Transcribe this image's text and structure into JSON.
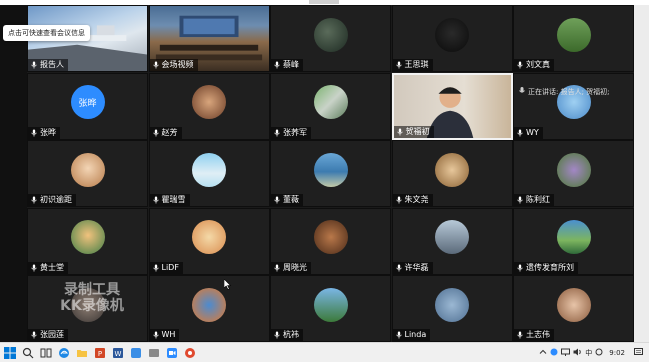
{
  "tooltip": "点击可快速查看会议信息",
  "speaking_indicator": "正在讲话: 报告人; 贺福初;",
  "watermark": {
    "line1": "录制工具",
    "line2": "KK录像机"
  },
  "tiles": [
    {
      "name": "报告人",
      "kind": "video-room"
    },
    {
      "name": "会场视频",
      "kind": "video-hall"
    },
    {
      "name": "蔡峰",
      "kind": "avatar-dark"
    },
    {
      "name": "王思琪",
      "kind": "avatar-dog"
    },
    {
      "name": "刘文真",
      "kind": "avatar-field"
    },
    {
      "name": "张晔",
      "kind": "initials",
      "initials": "张晔"
    },
    {
      "name": "赵芳",
      "kind": "avatar-cartoon"
    },
    {
      "name": "张荞军",
      "kind": "avatar-rail"
    },
    {
      "name": "贺福初",
      "kind": "video-person"
    },
    {
      "name": "WY",
      "kind": "avatar-sky"
    },
    {
      "name": "初识逾距",
      "kind": "avatar-face"
    },
    {
      "name": "瞿瑞雪",
      "kind": "avatar-beach"
    },
    {
      "name": "董薇",
      "kind": "avatar-coast"
    },
    {
      "name": "朱文尧",
      "kind": "avatar-bear"
    },
    {
      "name": "陈利红",
      "kind": "avatar-flowers"
    },
    {
      "name": "黄士堂",
      "kind": "avatar-man"
    },
    {
      "name": "LiDF",
      "kind": "avatar-girl"
    },
    {
      "name": "周晓光",
      "kind": "avatar-dog2"
    },
    {
      "name": "许华磊",
      "kind": "avatar-statue"
    },
    {
      "name": "遗传发育所刘",
      "kind": "avatar-lake"
    },
    {
      "name": "张园莲",
      "kind": "avatar-blur"
    },
    {
      "name": "WH",
      "kind": "avatar-kite"
    },
    {
      "name": "杭祎",
      "kind": "avatar-meadow"
    },
    {
      "name": "Linda",
      "kind": "avatar-moon"
    },
    {
      "name": "土志伟",
      "kind": "avatar-portrait"
    }
  ],
  "active_tile": "贺福初",
  "taskbar": {
    "ime_label": "中",
    "clock": "9:02"
  },
  "colors": {
    "grid_bg": "#1a1a1a",
    "initials_bg": "#2d8cff",
    "taskbar_bg": "#f0f0f0"
  }
}
